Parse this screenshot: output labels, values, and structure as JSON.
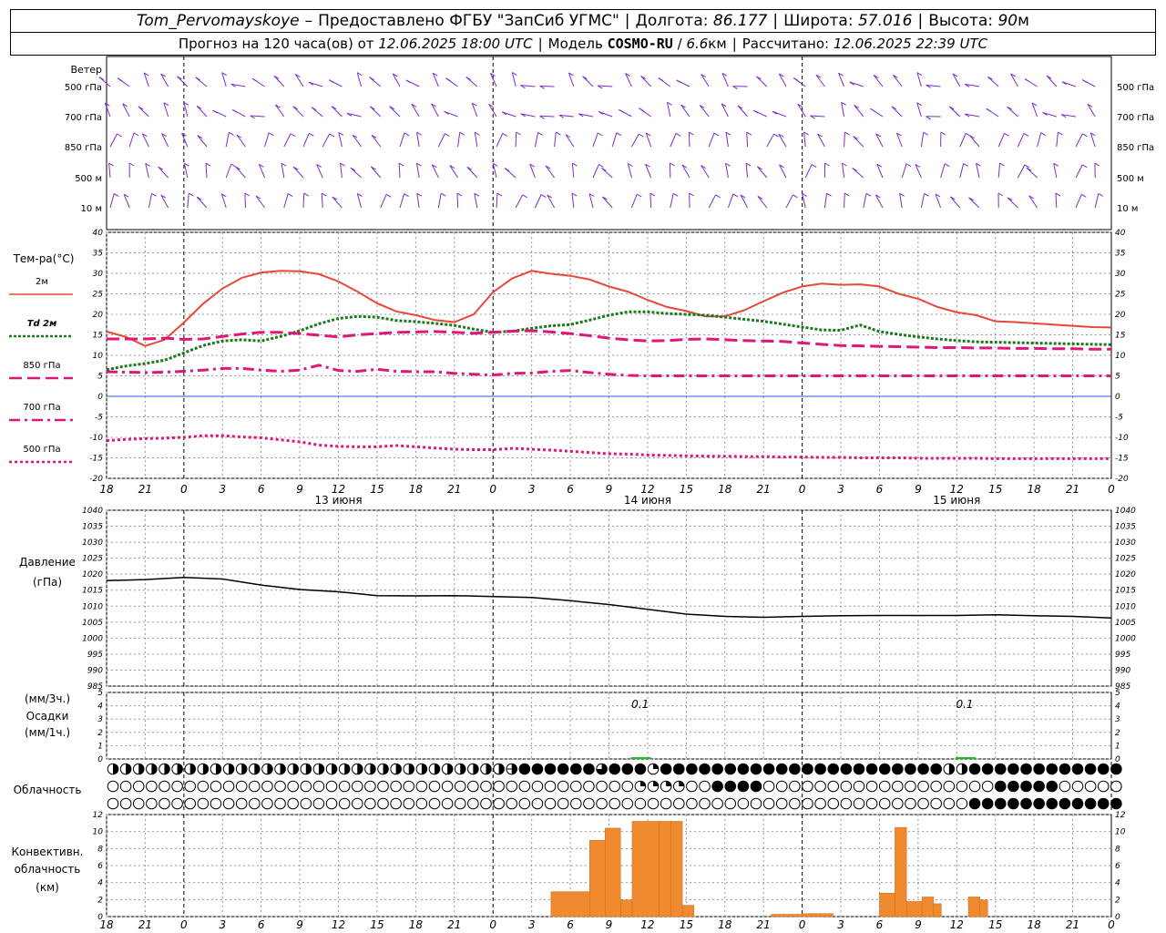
{
  "header": {
    "station": "Tom_Pervomayskoye",
    "dash": "–",
    "provided_by": "Предоставлено ФГБУ \"ЗапСиб УГМС\"",
    "lon_label": "Долгота:",
    "lon_value": "86.177",
    "lat_label": "Широта:",
    "lat_value": "57.016",
    "alt_label": "Высота:",
    "alt_value": "90",
    "alt_unit": "м",
    "forecast_label": "Прогноз на 120 часа(ов)",
    "from_label": "от",
    "forecast_start": "12.06.2025 18:00 UTC",
    "model_label": "Модель",
    "model_name": "COSMO-RU",
    "model_res": "6.6",
    "model_res_unit": "км",
    "computed_label": "Рассчитано:",
    "computed_at": "12.06.2025 22:39 UTC"
  },
  "time_axis": {
    "hour_labels": [
      "18",
      "21",
      "0",
      "3",
      "6",
      "9",
      "12",
      "15",
      "18",
      "21",
      "0",
      "3",
      "6",
      "9",
      "12",
      "15",
      "18",
      "21",
      "0",
      "3",
      "6",
      "9",
      "12",
      "15",
      "18",
      "21",
      "0"
    ],
    "day_labels": [
      {
        "index": 6,
        "label": "13 июня"
      },
      {
        "index": 14,
        "label": "14 июня"
      },
      {
        "index": 22,
        "label": "15 июня"
      }
    ]
  },
  "panels": {
    "wind": {
      "title": "Ветер",
      "levels": [
        "500 гПа",
        "700 гПа",
        "850 гПа",
        "500 м",
        "10   м"
      ],
      "color": "#7a2dc8"
    },
    "temperature": {
      "title": "Тем-ра(°C)",
      "legend": [
        {
          "label": "2м",
          "color": "#e8473a",
          "style": "solid"
        },
        {
          "label": "Td  2м",
          "color": "#1a7a1a",
          "style": "dotted"
        },
        {
          "label": "850 гПа",
          "color": "#e0167a",
          "style": "dash"
        },
        {
          "label": "700 гПа",
          "color": "#e0167a",
          "style": "dashdot"
        },
        {
          "label": "500 гПа",
          "color": "#e0167a",
          "style": "dot"
        }
      ]
    },
    "pressure": {
      "title_1": "Давление",
      "title_2": "(гПа)"
    },
    "precip": {
      "title_1": "(мм/3ч.)",
      "title_2": "Осадки",
      "title_3": "(мм/1ч.)",
      "annotations": [
        {
          "index": 13.9,
          "label": "0.1"
        },
        {
          "index": 22.3,
          "label": "0.1"
        }
      ],
      "color": "#22bb22"
    },
    "cloud": {
      "title": "Облачность"
    },
    "convective": {
      "title_1": "Конвективн.",
      "title_2": "облачность",
      "title_3": "(км)",
      "color": "#f08a30"
    }
  },
  "chart_data": [
    {
      "type": "line",
      "title": "Тем-ра(°C)",
      "x": [
        0,
        0.5,
        1,
        1.5,
        2,
        2.5,
        3,
        3.5,
        4,
        4.5,
        5,
        5.5,
        6,
        6.5,
        7,
        7.5,
        8,
        8.5,
        9,
        9.5,
        10,
        10.5,
        11,
        11.5,
        12,
        12.5,
        13,
        13.5,
        14,
        14.5,
        15,
        15.5,
        16,
        16.5,
        17,
        17.5,
        18,
        18.5,
        19,
        19.5,
        20,
        20.5,
        21,
        21.5,
        22,
        22.5,
        23,
        23.5,
        24,
        24.5,
        25,
        25.5,
        26
      ],
      "ylim": [
        -20,
        40
      ],
      "series": [
        {
          "name": "2м",
          "values": [
            15.8,
            14.5,
            12.3,
            13.8,
            18,
            22.6,
            26.3,
            28.9,
            30.2,
            30.6,
            30.5,
            29.8,
            28,
            25.5,
            22.7,
            20.7,
            19.8,
            18.6,
            18.1,
            20,
            25.4,
            28.8,
            30.6,
            29.9,
            29.4,
            28.5,
            26.8,
            25.5,
            23.5,
            21.8,
            20.8,
            19.5,
            19.5,
            21,
            23.2,
            25.3,
            26.8,
            27.5,
            27.2,
            27.3,
            26.8,
            25,
            23.8,
            21.8,
            20.5,
            19.8,
            18.3,
            18.1,
            17.8,
            17.5,
            17.2,
            16.9,
            16.8
          ]
        },
        {
          "name": "Td  2м",
          "values": [
            6.5,
            7.4,
            8,
            8.8,
            10.6,
            12.4,
            13.5,
            13.8,
            13.5,
            14.6,
            16,
            17.7,
            19,
            19.5,
            19.3,
            18.5,
            18.2,
            17.8,
            17.3,
            16.4,
            15.6,
            15.9,
            16.6,
            17.2,
            17.5,
            18.6,
            19.8,
            20.6,
            20.6,
            20.2,
            20,
            19.8,
            19.3,
            18.8,
            18.3,
            17.6,
            16.9,
            16.2,
            16.1,
            17.4,
            15.8,
            15.1,
            14.5,
            14.0,
            13.6,
            13.3,
            13.2,
            13.1,
            13.0,
            12.9,
            12.8,
            12.7,
            12.6
          ]
        },
        {
          "name": "850 гПа",
          "values": [
            14,
            14,
            14,
            14.2,
            13.9,
            14,
            14.6,
            15.2,
            15.6,
            15.6,
            15.3,
            14.9,
            14.5,
            15,
            15.3,
            15.6,
            15.7,
            15.8,
            15.6,
            15.4,
            15.6,
            15.9,
            16,
            15.7,
            15.3,
            14.8,
            14.2,
            13.8,
            13.5,
            13.6,
            13.9,
            14,
            13.8,
            13.6,
            13.5,
            13.4,
            13.0,
            12.7,
            12.4,
            12.3,
            12.2,
            12.1,
            12.0,
            11.9,
            11.9,
            11.8,
            11.8,
            11.7,
            11.7,
            11.6,
            11.6,
            11.5,
            11.5
          ]
        },
        {
          "name": "700 гПа",
          "values": [
            6,
            5.9,
            5.8,
            5.9,
            6.1,
            6.4,
            6.8,
            6.8,
            6.4,
            6.1,
            6.4,
            7.6,
            6.3,
            6.1,
            6.6,
            6.1,
            6.0,
            6.0,
            5.6,
            5.4,
            5.2,
            5.6,
            5.7,
            6.1,
            6.3,
            5.8,
            5.4,
            5.1,
            5.0,
            5.0,
            5.0,
            5.0,
            5.0,
            5.0,
            5.0,
            5.0,
            5.0,
            5.0,
            5.0,
            5.0,
            5.0,
            5.0,
            5.0,
            5.0,
            5.0,
            5.0,
            5.0,
            5.0,
            5.0,
            5.0,
            5.0,
            5.0,
            5.0
          ]
        },
        {
          "name": "500 гПа",
          "values": [
            -10.8,
            -10.5,
            -10.3,
            -10.2,
            -10,
            -9.6,
            -9.6,
            -9.9,
            -10.1,
            -10.6,
            -11.1,
            -11.9,
            -12.2,
            -12.3,
            -12.3,
            -12,
            -12.3,
            -12.6,
            -12.9,
            -13,
            -13,
            -12.7,
            -12.9,
            -13.1,
            -13.4,
            -13.7,
            -14,
            -14.1,
            -14.3,
            -14.4,
            -14.5,
            -14.6,
            -14.6,
            -14.7,
            -14.7,
            -14.8,
            -14.8,
            -14.9,
            -14.9,
            -15.0,
            -15.0,
            -15.0,
            -15.1,
            -15.1,
            -15.1,
            -15.1,
            -15.2,
            -15.2,
            -15.2,
            -15.2,
            -15.2,
            -15.2,
            -15.2
          ]
        }
      ]
    },
    {
      "type": "line",
      "title": "Давление",
      "x": [
        0,
        1,
        2,
        3,
        4,
        5,
        6,
        7,
        8,
        9,
        10,
        11,
        12,
        13,
        14,
        15,
        16,
        17,
        18,
        19,
        20,
        21,
        22,
        23,
        24,
        25,
        26
      ],
      "ylim": [
        985,
        1040
      ],
      "series": [
        {
          "name": "Давление",
          "values": [
            1018,
            1018.3,
            1019,
            1018.5,
            1016.6,
            1015.2,
            1014.5,
            1013.3,
            1013.2,
            1013.3,
            1013.0,
            1012.7,
            1011.7,
            1010.5,
            1009,
            1007.5,
            1006.8,
            1006.5,
            1006.8,
            1007,
            1007.1,
            1007.1,
            1007.1,
            1007.3,
            1007,
            1006.8,
            1006.3
          ]
        }
      ]
    },
    {
      "type": "bar",
      "title": "Конвективн. облачность (км)",
      "ylim": [
        0,
        13.5
      ],
      "bars": [
        {
          "x0": 11.5,
          "x1": 12.5,
          "value": 3.3
        },
        {
          "x0": 12.5,
          "x1": 12.9,
          "value": 10.1
        },
        {
          "x0": 12.9,
          "x1": 13.3,
          "value": 11.7
        },
        {
          "x0": 13.3,
          "x1": 13.6,
          "value": 2.2
        },
        {
          "x0": 13.6,
          "x1": 14.3,
          "value": 12.6
        },
        {
          "x0": 14.3,
          "x1": 14.6,
          "value": 12.6
        },
        {
          "x0": 14.6,
          "x1": 14.9,
          "value": 12.6
        },
        {
          "x0": 14.9,
          "x1": 15.2,
          "value": 1.5
        },
        {
          "x0": 17.2,
          "x1": 18.0,
          "value": 0.3
        },
        {
          "x0": 18.0,
          "x1": 18.8,
          "value": 0.4
        },
        {
          "x0": 20.0,
          "x1": 20.4,
          "value": 3.1
        },
        {
          "x0": 20.4,
          "x1": 20.7,
          "value": 11.8
        },
        {
          "x0": 20.7,
          "x1": 21.1,
          "value": 2.0
        },
        {
          "x0": 21.1,
          "x1": 21.4,
          "value": 2.6
        },
        {
          "x0": 21.4,
          "x1": 21.6,
          "value": 1.7
        },
        {
          "x0": 22.3,
          "x1": 22.6,
          "value": 2.6
        },
        {
          "x0": 22.6,
          "x1": 22.8,
          "value": 2.2
        }
      ]
    }
  ],
  "cloud_rows": [
    "HHHHHHHHHHHHHHHHHHHHHHHHHHHHHHH5FFFFFF6FFF4FFFFFFFFFFFFFFFFFFFFFFHHFFFFFFFFFFFFFFFFFFFFFFFFFFFFFFFFF",
    "OOOOOOOOOOOOOOOOOOOOOOOOOOOOOOOOOOOOOOOOO4444OOFFFFOOOOOOOOOOOOOOOOOOFFFFFOOOOOOOOOOOOOOOOOOFOOOOOOO",
    "OOOOOOOOOOOOOOOOOOOOOOOOOOOOOOOOOOOOOOOOOOOOOOOOOOOOOOOOOOOOOOOOOOOFFFFFFFFFFFFFFFFFFFFFFFFFFFFFFFF"
  ]
}
